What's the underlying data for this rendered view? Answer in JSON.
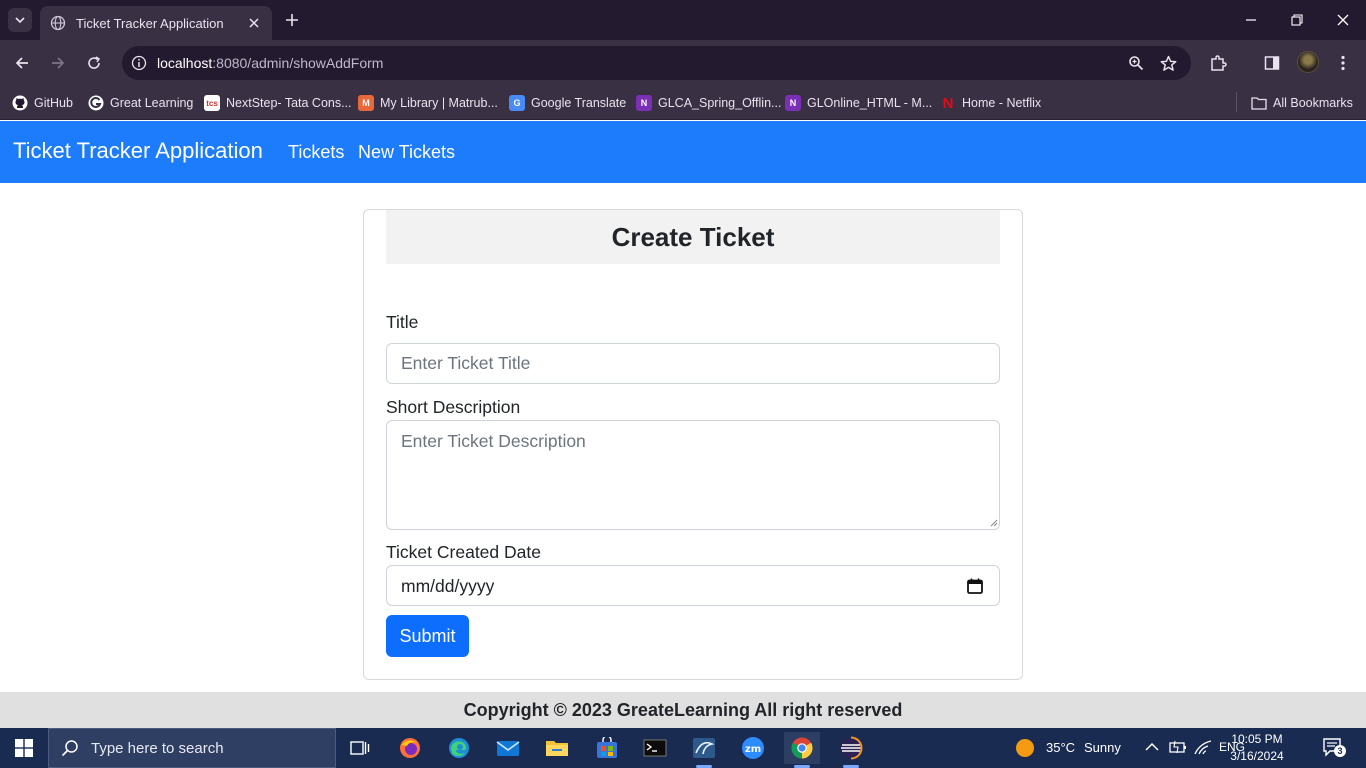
{
  "browser": {
    "tab_title": "Ticket Tracker Application",
    "url_host": "localhost",
    "url_path": ":8080/admin/showAddForm",
    "bookmarks": [
      {
        "label": "GitHub",
        "icon": "github-icon"
      },
      {
        "label": "Great Learning",
        "icon": "great-learning-icon"
      },
      {
        "label": "NextStep- Tata Cons...",
        "icon": "tcs-icon"
      },
      {
        "label": "My Library | Matrub...",
        "icon": "matrubharti-icon"
      },
      {
        "label": "Google Translate",
        "icon": "google-translate-icon"
      },
      {
        "label": "GLCA_Spring_Offlin...",
        "icon": "onenote-icon"
      },
      {
        "label": "GLOnline_HTML - M...",
        "icon": "onenote-icon"
      },
      {
        "label": "Home - Netflix",
        "icon": "netflix-icon"
      }
    ],
    "all_bookmarks_label": "All Bookmarks"
  },
  "navbar": {
    "brand": "Ticket Tracker Application",
    "links": [
      "Tickets",
      "New Tickets"
    ],
    "color": "#1c7cfc"
  },
  "form": {
    "heading": "Create Ticket",
    "title_label": "Title",
    "title_placeholder": "Enter Ticket Title",
    "description_label": "Short Description",
    "description_placeholder": "Enter Ticket Description",
    "date_label": "Ticket Created Date",
    "date_placeholder": "mm/dd/yyyy",
    "submit_label": "Submit",
    "submit_color": "#0d6efd"
  },
  "footer": {
    "text": "Copyright © 2023 GreateLearning All right reserved"
  },
  "taskbar": {
    "search_placeholder": "Type here to search",
    "weather_temp": "35°C",
    "weather_desc": "Sunny",
    "language": "ENG",
    "time": "10:05 PM",
    "date": "3/16/2024",
    "notification_count": "3"
  }
}
